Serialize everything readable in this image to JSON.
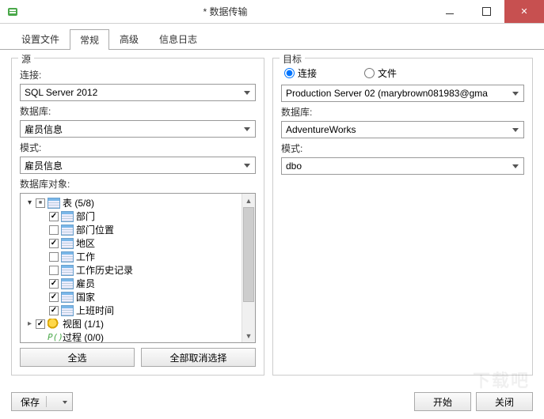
{
  "window": {
    "title": "* 数据传输"
  },
  "tabs": {
    "settings_file": "设置文件",
    "general": "常规",
    "advanced": "高级",
    "log": "信息日志"
  },
  "source": {
    "legend": "源",
    "connection_label": "连接:",
    "connection_value": "SQL Server 2012",
    "database_label": "数据库:",
    "database_value": "雇员信息",
    "schema_label": "模式:",
    "schema_value": "雇员信息",
    "objects_label": "数据库对象:",
    "tree": {
      "tables_label": "表  (5/8)",
      "items": [
        {
          "label": "部门",
          "checked": true
        },
        {
          "label": "部门位置",
          "checked": false
        },
        {
          "label": "地区",
          "checked": true
        },
        {
          "label": "工作",
          "checked": false
        },
        {
          "label": "工作历史记录",
          "checked": false
        },
        {
          "label": "雇员",
          "checked": true
        },
        {
          "label": "国家",
          "checked": true
        },
        {
          "label": "上班时间",
          "checked": true
        }
      ],
      "views_label": "视图  (1/1)",
      "procs_label": "过程  (0/0)"
    },
    "select_all": "全选",
    "deselect_all": "全部取消选择"
  },
  "target": {
    "legend": "目标",
    "radio_connection": "连接",
    "radio_file": "文件",
    "connection_value": "Production Server 02 (marybrown081983@gma",
    "database_label": "数据库:",
    "database_value": "AdventureWorks",
    "schema_label": "模式:",
    "schema_value": "dbo"
  },
  "footer": {
    "save": "保存",
    "start": "开始",
    "close": "关闭"
  }
}
